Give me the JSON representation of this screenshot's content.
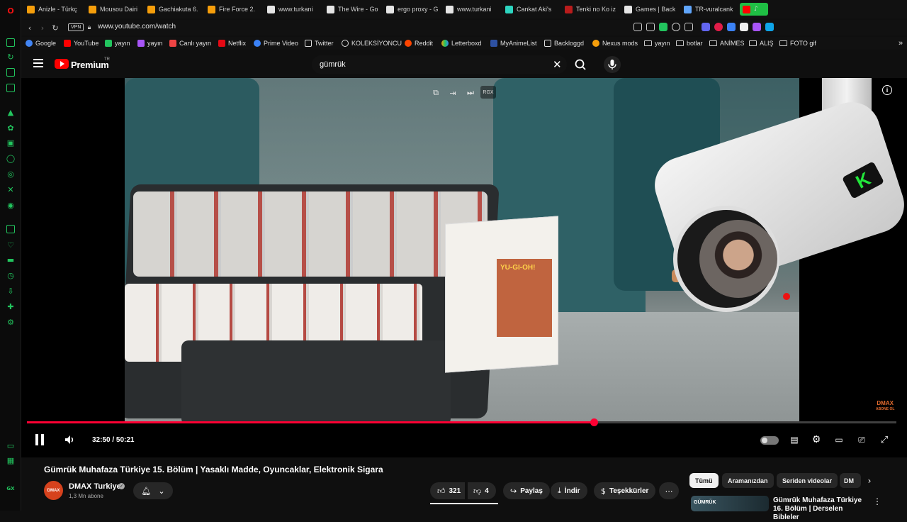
{
  "browser": {
    "tabs": [
      {
        "label": "Anizle - Türkç",
        "color": "#f59e0b"
      },
      {
        "label": "Mousou Dairi",
        "color": "#f59e0b"
      },
      {
        "label": "Gachiakuta 6.",
        "color": "#f59e0b"
      },
      {
        "label": "Fire Force 2.",
        "color": "#f59e0b"
      },
      {
        "label": "www.turkani",
        "color": "#e5e5e5"
      },
      {
        "label": "The Wire - Go",
        "color": "#e5e5e5"
      },
      {
        "label": "ergo proxy - G",
        "color": "#e5e5e5"
      },
      {
        "label": "www.turkani",
        "color": "#e5e5e5"
      },
      {
        "label": "Cankat Aki's",
        "color": "#2dd4bf"
      },
      {
        "label": "Tenki no Ko iz",
        "color": "#b91c1c"
      },
      {
        "label": "Games | Back",
        "color": "#e5e5e5"
      },
      {
        "label": "TR-vuralcank",
        "color": "#60a5fa"
      }
    ],
    "url": "www.youtube.com/watch",
    "vpn_label": "VPN",
    "bookmarks": [
      {
        "label": "Google",
        "color": "#4285f4"
      },
      {
        "label": "YouTube",
        "color": "#ff0000"
      },
      {
        "label": "yayın",
        "color": "#22c55e"
      },
      {
        "label": "yayın",
        "color": "#a855f7"
      },
      {
        "label": "Canlı yayın",
        "color": "#ef4444"
      },
      {
        "label": "Netflix",
        "color": "#e50914"
      },
      {
        "label": "Prime Video",
        "color": "#3b82f6"
      },
      {
        "label": "Twitter",
        "color": "#e5e5e5"
      },
      {
        "label": "KOLEKSİYONCU",
        "color": "#e5e5e5"
      },
      {
        "label": "Reddit",
        "color": "#ff4500"
      },
      {
        "label": "Letterboxd",
        "color": "#22c55e"
      },
      {
        "label": "MyAnimeList",
        "color": "#2e51a2"
      },
      {
        "label": "Backloggd",
        "color": "#e5e5e5"
      },
      {
        "label": "Nexus mods",
        "color": "#f59e0b"
      }
    ],
    "bookmark_folders": [
      "yayın",
      "botlar",
      "ANİMES",
      "ALIŞ",
      "FOTO gif"
    ]
  },
  "youtube": {
    "logo_text": "Premium",
    "region": "TR",
    "search_value": "gümrük",
    "player": {
      "rgx_label": "RGX",
      "current_time": "32:50",
      "duration": "50:21",
      "time_display": "32:50 / 50:21",
      "progress_fraction": 0.652,
      "box_title": "YU-GI-OH!",
      "watermark": "DMAX",
      "watermark_sub": "ABONE OL",
      "camera_badge": "K"
    },
    "video": {
      "title": "Gümrük Muhafaza Türkiye 15. Bölüm | Yasaklı Madde, Oyuncaklar, Elektronik Sigara",
      "channel": "DMAX Turkiye",
      "channel_avatar": "DMAX",
      "subscribers": "1,3 Mn abone",
      "likes": "321",
      "dislikes": "4",
      "share_label": "Paylaş",
      "download_label": "İndir",
      "thanks_label": "Teşekkürler"
    },
    "chips": [
      "Tümü",
      "Aramanızdan",
      "Seriden videolar",
      "DM"
    ],
    "recommendation": {
      "title": "Gümrük Muhafaza Türkiye 16. Bölüm | Derselen Bibleler",
      "thumb_text": "GÜMRÜK"
    }
  }
}
